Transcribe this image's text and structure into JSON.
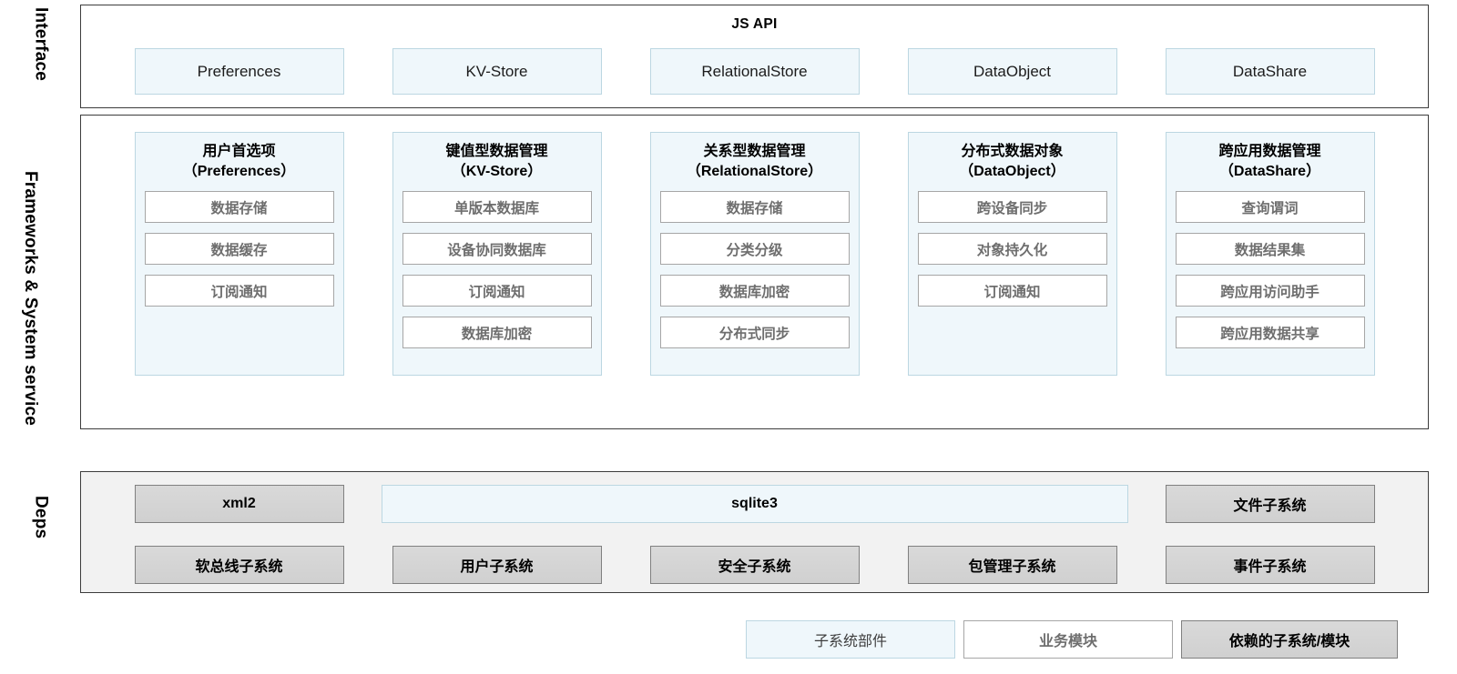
{
  "bands": {
    "interface": "Interface",
    "frameworks": "Frameworks & System service",
    "deps": "Deps"
  },
  "interface": {
    "title": "JS API",
    "apis": [
      {
        "label": "Preferences"
      },
      {
        "label": "KV-Store"
      },
      {
        "label": "RelationalStore"
      },
      {
        "label": "DataObject"
      },
      {
        "label": "DataShare"
      }
    ]
  },
  "frameworks": {
    "groups": [
      {
        "title": "用户首选项\n（Preferences）",
        "modules": [
          "数据存储",
          "数据缓存",
          "订阅通知"
        ]
      },
      {
        "title": "键值型数据管理\n（KV-Store）",
        "modules": [
          "单版本数据库",
          "设备协同数据库",
          "订阅通知",
          "数据库加密"
        ]
      },
      {
        "title": "关系型数据管理\n（RelationalStore）",
        "modules": [
          "数据存储",
          "分类分级",
          "数据库加密",
          "分布式同步"
        ]
      },
      {
        "title": "分布式数据对象\n（DataObject）",
        "modules": [
          "跨设备同步",
          "对象持久化",
          "订阅通知"
        ]
      },
      {
        "title": "跨应用数据管理\n（DataShare）",
        "modules": [
          "查询谓词",
          "数据结果集",
          "跨应用访问助手",
          "跨应用数据共享"
        ]
      }
    ]
  },
  "deps": {
    "row1": [
      {
        "label": "xml2",
        "style": "dependency"
      },
      {
        "label": "sqlite3",
        "style": "component",
        "span": 3
      },
      {
        "label": "文件子系统",
        "style": "dependency"
      }
    ],
    "row2": [
      {
        "label": "软总线子系统",
        "style": "dependency"
      },
      {
        "label": "用户子系统",
        "style": "dependency"
      },
      {
        "label": "安全子系统",
        "style": "dependency"
      },
      {
        "label": "包管理子系统",
        "style": "dependency"
      },
      {
        "label": "事件子系统",
        "style": "dependency"
      }
    ]
  },
  "legend": [
    {
      "label": "子系统部件",
      "style": "component"
    },
    {
      "label": "业务模块",
      "style": "module"
    },
    {
      "label": "依赖的子系统/模块",
      "style": "dependency"
    }
  ],
  "colors": {
    "component_fill": "#eff7fb",
    "component_border": "#bcd7e2",
    "module_fill": "#ffffff",
    "module_border": "#a6a6a6",
    "module_text": "#6e6e6e",
    "dependency_fill": "#d9d9d9",
    "dependency_border": "#808080",
    "panel_border": "#3c3c3c",
    "deps_panel_fill": "#f2f2f2"
  }
}
